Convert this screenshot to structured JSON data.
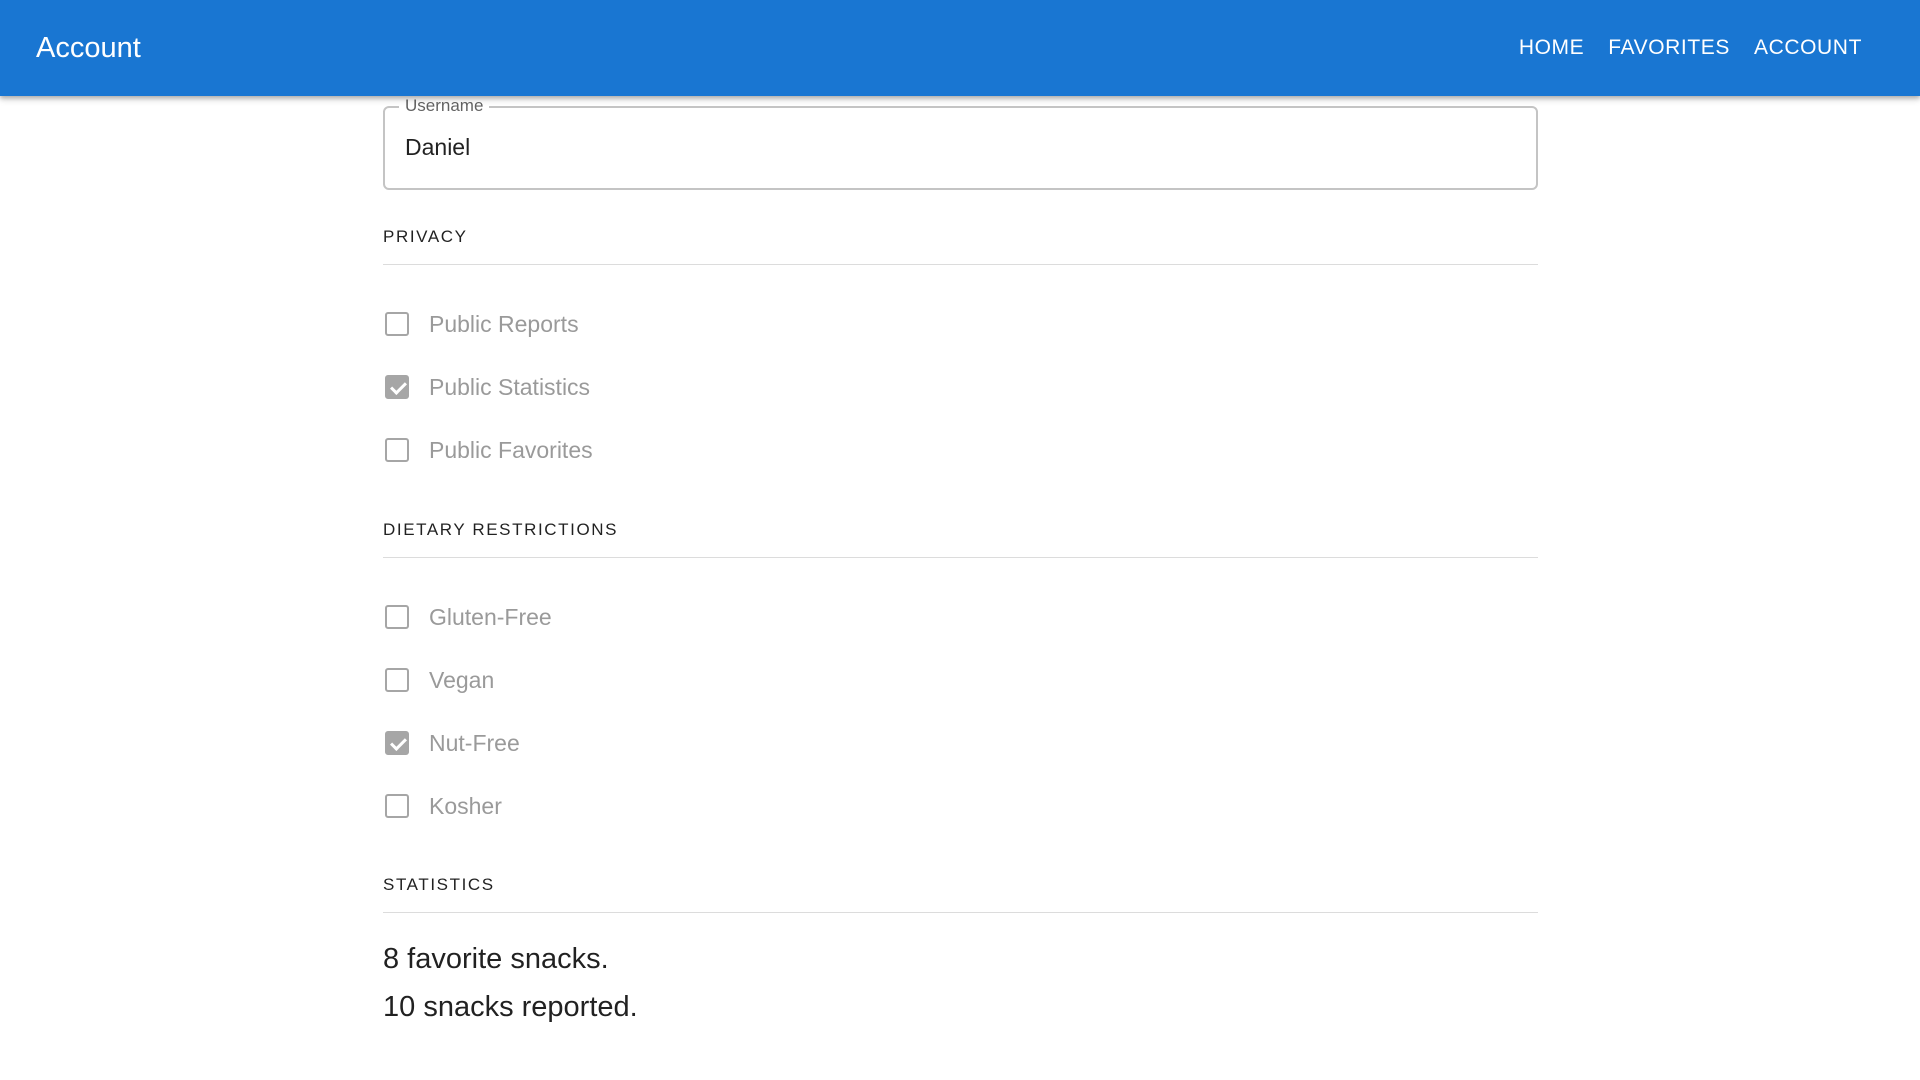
{
  "appbar": {
    "title": "Account",
    "nav": [
      "HOME",
      "FAVORITES",
      "ACCOUNT"
    ]
  },
  "username": {
    "label": "Username",
    "value": "Daniel"
  },
  "privacy": {
    "heading": "PRIVACY",
    "options": [
      {
        "label": "Public Reports",
        "checked": false
      },
      {
        "label": "Public Statistics",
        "checked": true
      },
      {
        "label": "Public Favorites",
        "checked": false
      }
    ]
  },
  "dietary": {
    "heading": "DIETARY RESTRICTIONS",
    "options": [
      {
        "label": "Gluten-Free",
        "checked": false
      },
      {
        "label": "Vegan",
        "checked": false
      },
      {
        "label": "Nut-Free",
        "checked": true
      },
      {
        "label": "Kosher",
        "checked": false
      }
    ]
  },
  "statistics": {
    "heading": "STATISTICS",
    "favorites_text": "8 favorite snacks.",
    "reported_text": "10 snacks reported."
  },
  "colors": {
    "appbar": "#1976d2",
    "checkbox_disabled": "#a6a6a6"
  }
}
